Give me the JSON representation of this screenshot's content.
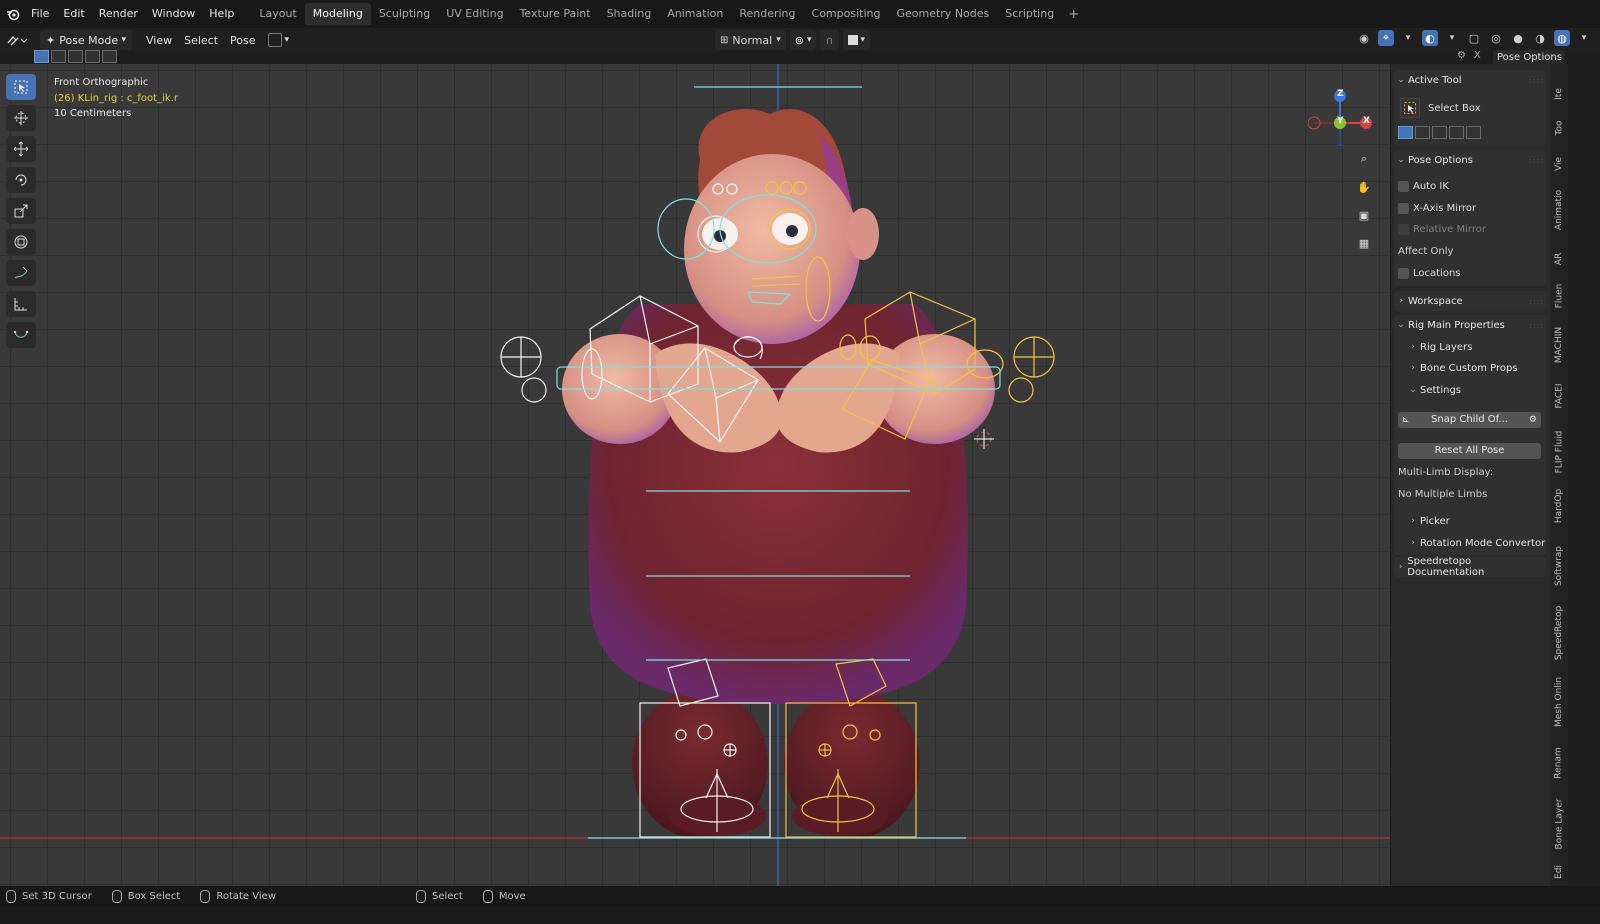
{
  "topbar": {
    "menus": [
      "File",
      "Edit",
      "Render",
      "Window",
      "Help"
    ],
    "workspaces": [
      "Layout",
      "Modeling",
      "Sculpting",
      "UV Editing",
      "Texture Paint",
      "Shading",
      "Animation",
      "Rendering",
      "Compositing",
      "Geometry Nodes",
      "Scripting"
    ],
    "active_workspace": "Modeling",
    "add_label": "+"
  },
  "header": {
    "mode": "Pose Mode",
    "menus": [
      "View",
      "Select",
      "Pose"
    ],
    "orientation": "Normal"
  },
  "viewport": {
    "view_name": "Front Orthographic",
    "active_object": "(26) KLin_rig : c_foot_ik.r",
    "scale": "10 Centimeters",
    "gizmo": {
      "x": "X",
      "y": "Y",
      "z": "Z"
    }
  },
  "sidebar": {
    "options_button": "Pose Options",
    "close_label": "X",
    "active_tool": {
      "title": "Active Tool",
      "tool_name": "Select Box"
    },
    "pose_options": {
      "title": "Pose Options",
      "auto_ik": "Auto IK",
      "x_axis_mirror": "X-Axis Mirror",
      "relative_mirror": "Relative Mirror",
      "affect_only": "Affect Only",
      "locations": "Locations"
    },
    "workspace": "Workspace",
    "rig_main": {
      "title": "Rig Main Properties",
      "rig_layers": "Rig Layers",
      "bone_custom_props": "Bone Custom Props",
      "settings": "Settings",
      "snap_child": "Snap Child Of...",
      "reset_all": "Reset All Pose",
      "multi_limb_label": "Multi-Limb Display:",
      "multi_limb_value": "No Multiple Limbs",
      "picker": "Picker",
      "rotation_mode": "Rotation Mode Convertor"
    },
    "speedretopo": "Speedretopo Documentation",
    "tabs": [
      "Ite",
      "Too",
      "Vie",
      "Animatio",
      "AR",
      "Fluen",
      "MACHIN",
      "FACEI",
      "FLIP Fluid",
      "HardOp",
      "Softwrap",
      "SpeedRetop",
      "Mesh Onlin",
      "Renam",
      "Bone Layer",
      "Edi"
    ]
  },
  "statusbar": {
    "items": [
      "Set 3D Cursor",
      "Box Select",
      "Rotate View",
      "Select",
      "Move"
    ]
  },
  "colors": {
    "accent": "#4772b3",
    "bone_white": "#f2f2f2",
    "bone_yellow": "#f5c342",
    "bone_cyan": "#7fe0e0",
    "shirt": "#7a2b33",
    "skin": "#e2a88f",
    "hair": "#a3493a"
  }
}
